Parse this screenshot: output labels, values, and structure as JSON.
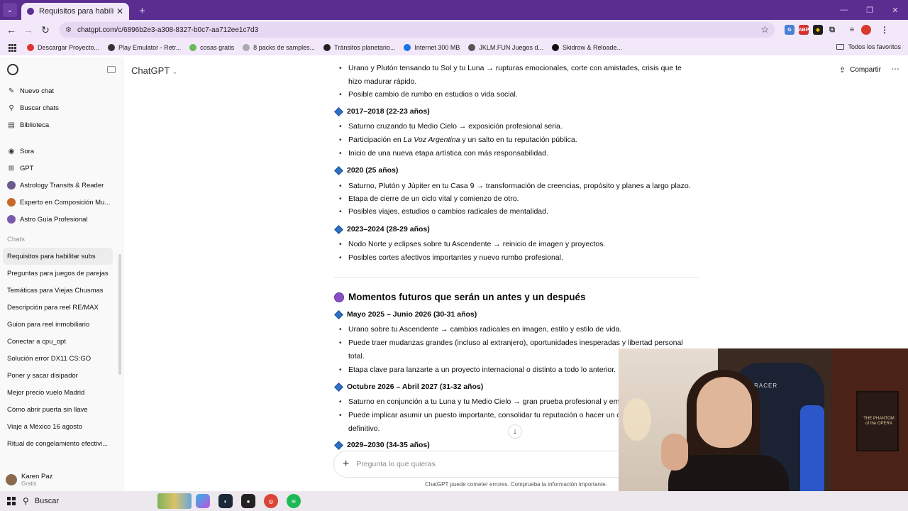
{
  "browser": {
    "tab_title": "Requisitos para habilitar subs",
    "url": "chatgpt.com/c/6896b2e3-a308-8327-b0c7-aa712ee1c7d3",
    "bookmarks": [
      {
        "label": "Descargar Proyecto...",
        "color": "#d33"
      },
      {
        "label": "Play Emulator - Retr...",
        "color": "#333"
      },
      {
        "label": "cosas gratis",
        "color": "#6b5"
      },
      {
        "label": "8 packs de samples...",
        "color": "#aaa"
      },
      {
        "label": "Tránsitos planetario...",
        "color": "#222"
      },
      {
        "label": "Internet 300 MB",
        "color": "#1a73e8"
      },
      {
        "label": "JKLM.FUN Juegos d...",
        "color": "#555"
      },
      {
        "label": "Skidrow & Reloade...",
        "color": "#111"
      }
    ],
    "all_favorites": "Todos los favoritos"
  },
  "sidebar": {
    "nav": [
      {
        "label": "Nuevo chat",
        "icon": "edit-icon"
      },
      {
        "label": "Buscar chats",
        "icon": "search-icon"
      },
      {
        "label": "Biblioteca",
        "icon": "library-icon"
      }
    ],
    "gpts": [
      {
        "label": "Sora",
        "icon": "sora-icon"
      },
      {
        "label": "GPT",
        "icon": "grid-icon"
      },
      {
        "label": "Astrology Transits & Reader",
        "icon": "astrology-avatar"
      },
      {
        "label": "Experto en Composición Mu...",
        "icon": "music-avatar"
      },
      {
        "label": "Astro Guía Profesional",
        "icon": "astro-avatar"
      }
    ],
    "chats_label": "Chats",
    "chats": [
      "Requisitos para habilitar subs",
      "Preguntas para juegos de parejas",
      "Temáticas para Viejas Chusmas",
      "Descripción para reel RE/MAX",
      "Guion para reel inmobiliario",
      "Conectar a cpu_opt",
      "Solución error DX11 CS:GO",
      "Poner y sacar disipador",
      "Mejor precio vuelo Madrid",
      "Cómo abrir puerta sin llave",
      "Viaje a México 16 agosto",
      "Ritual de congelamiento efectivi..."
    ],
    "user": {
      "name": "Karen Paz",
      "plan": "Gratis"
    }
  },
  "header": {
    "model": "ChatGPT",
    "share": "Compartir"
  },
  "content": {
    "top_bullets": [
      "Urano y Plutón tensando tu Sol y tu Luna → rupturas emocionales, corte con amistades, crisis que te",
      "hizo madurar rápido.",
      "Posible cambio de rumbo en estudios o vida social."
    ],
    "s2017": {
      "title": "2017–2018 (22-23 años)",
      "b1": "Saturno cruzando tu Medio Cielo → exposición profesional seria.",
      "b2a": "Participación en ",
      "b2em": "La Voz Argentina",
      "b2b": " y un salto en tu reputación pública.",
      "b3": "Inicio de una nueva etapa artística con más responsabilidad."
    },
    "s2020": {
      "title": "2020 (25 años)",
      "bullets": [
        "Saturno, Plutón y Júpiter en tu Casa 9 → transformación de creencias, propósito y planes a largo plazo.",
        "Etapa de cierre de un ciclo vital y comienzo de otro.",
        "Posibles viajes, estudios o cambios radicales de mentalidad."
      ]
    },
    "s2023": {
      "title": "2023–2024 (28-29 años)",
      "bullets": [
        "Nodo Norte y eclipses sobre tu Ascendente → reinicio de imagen y proyectos.",
        "Posibles cortes afectivos importantes y nuevo rumbo profesional."
      ]
    },
    "future_heading": "Momentos futuros que serán un antes y un después",
    "s2025": {
      "title": "Mayo 2025 – Junio 2026 (30-31 años)",
      "b1": "Urano sobre tu Ascendente → cambios radicales en imagen, estilo y estilo de vida.",
      "b2": "Puede traer mudanzas grandes (incluso al extranjero), oportunidades inesperadas y libertad personal",
      "b2c": "total.",
      "b3": "Etapa clave para lanzarte a un proyecto internacional o distinto a todo lo anterior."
    },
    "s2026": {
      "title": "Octubre 2026 – Abril 2027 (31-32 años)",
      "b1": "Saturno en conjunción a tu Luna y tu Medio Cielo → gran prueba profesional y emocional.",
      "b2": "Puede implicar asumir un puesto importante, consolidar tu reputación o hacer un cambio",
      "b2c": "definitivo."
    },
    "s2029": {
      "title": "2029–2030 (34-35 años)"
    }
  },
  "composer": {
    "placeholder": "Pregunta lo que quieras"
  },
  "disclaimer": "ChatGPT puede cometer errores. Comprueba la información importante.",
  "webcam": {
    "chair_brand": "DXRACER",
    "poster_text": "THE PHANTOM of the OPERA"
  },
  "taskbar": {
    "search": "Buscar"
  },
  "colors": {
    "browser_frame": "#5c2d91",
    "accent_diamond": "#2f6fc4"
  }
}
